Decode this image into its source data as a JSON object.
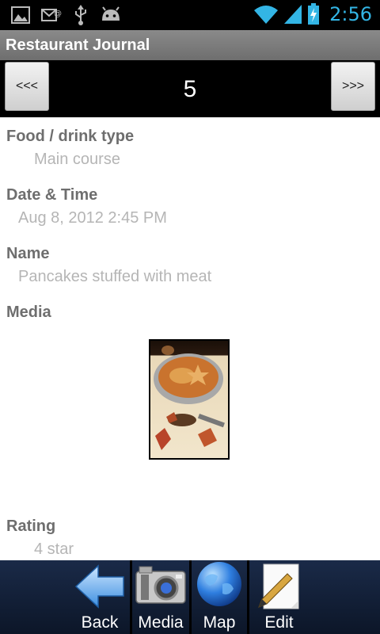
{
  "status_bar": {
    "time": "2:56",
    "notification_icons": [
      "image-icon",
      "mail-icon",
      "usb-icon",
      "android-icon"
    ],
    "system_icons": [
      "wifi-icon",
      "signal-icon",
      "battery-charging-icon"
    ],
    "accent_color": "#33b5e5"
  },
  "app": {
    "title": "Restaurant Journal"
  },
  "nav": {
    "prev_label": "<<<",
    "next_label": ">>>",
    "current": "5"
  },
  "fields": {
    "type_label": "Food / drink type",
    "type_value": "Main course",
    "date_label": "Date & Time",
    "date_value": "Aug 8, 2012 2:45 PM",
    "name_label": "Name",
    "name_value": "Pancakes stuffed with meat",
    "media_label": "Media",
    "rating_label": "Rating",
    "rating_value": "4 star"
  },
  "toolbar": {
    "back_label": "Back",
    "media_label": "Media",
    "map_label": "Map",
    "edit_label": "Edit"
  }
}
